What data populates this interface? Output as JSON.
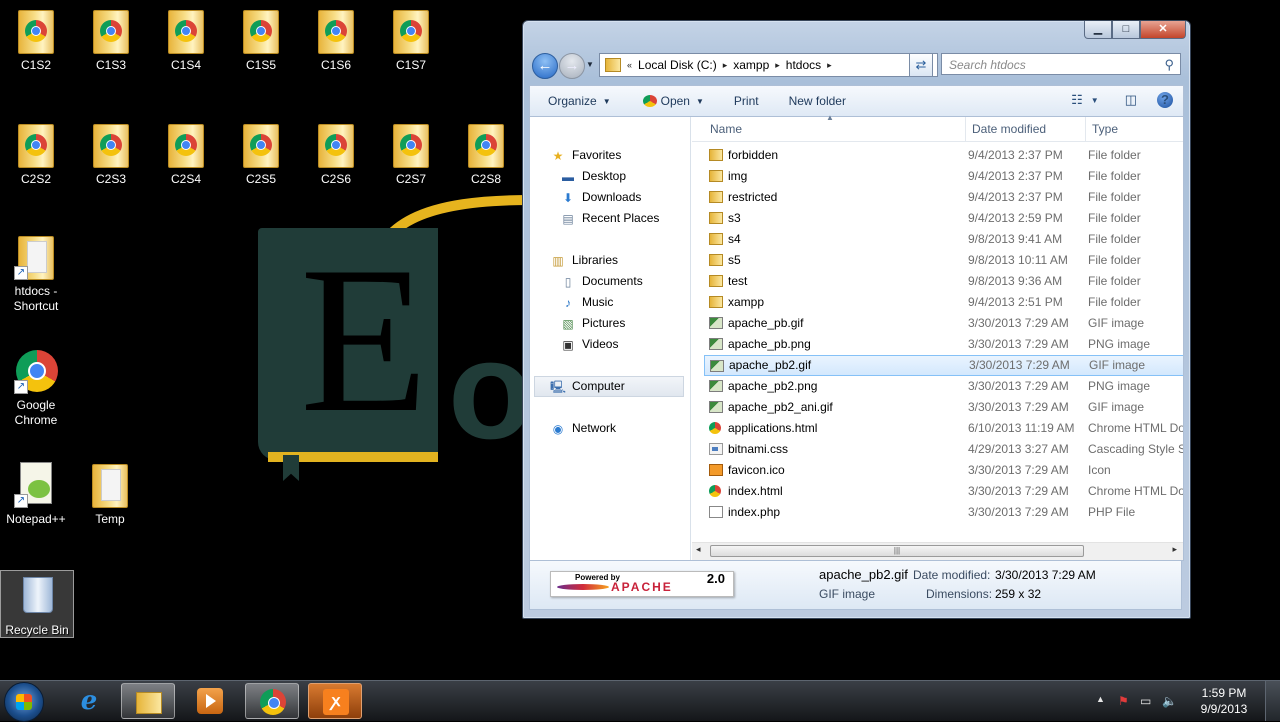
{
  "desktop": {
    "icons_row1": [
      "C1S2",
      "C1S3",
      "C1S4",
      "C1S5",
      "C1S6",
      "C1S7"
    ],
    "icons_row2": [
      "C2S2",
      "C2S3",
      "C2S4",
      "C2S5",
      "C2S6",
      "C2S7",
      "C2S8"
    ],
    "shortcut_htdocs": "htdocs - Shortcut",
    "chrome": "Google Chrome",
    "notepad": "Notepad++",
    "temp": "Temp",
    "recycle": "Recycle Bin"
  },
  "explorer": {
    "address": {
      "segments": [
        "Local Disk (C:)",
        "xampp",
        "htdocs"
      ]
    },
    "search_placeholder": "Search htdocs",
    "toolbar": {
      "organize": "Organize",
      "open": "Open",
      "print": "Print",
      "new_folder": "New folder"
    },
    "nav": {
      "favorites": "Favorites",
      "desktop": "Desktop",
      "downloads": "Downloads",
      "recent": "Recent Places",
      "libraries": "Libraries",
      "documents": "Documents",
      "music": "Music",
      "pictures": "Pictures",
      "videos": "Videos",
      "computer": "Computer",
      "network": "Network"
    },
    "columns": {
      "name": "Name",
      "date": "Date modified",
      "type": "Type"
    },
    "files": [
      {
        "name": "forbidden",
        "date": "9/4/2013 2:37 PM",
        "type": "File folder",
        "icon": "folder"
      },
      {
        "name": "img",
        "date": "9/4/2013 2:37 PM",
        "type": "File folder",
        "icon": "folder"
      },
      {
        "name": "restricted",
        "date": "9/4/2013 2:37 PM",
        "type": "File folder",
        "icon": "folder"
      },
      {
        "name": "s3",
        "date": "9/4/2013 2:59 PM",
        "type": "File folder",
        "icon": "folder"
      },
      {
        "name": "s4",
        "date": "9/8/2013 9:41 AM",
        "type": "File folder",
        "icon": "folder"
      },
      {
        "name": "s5",
        "date": "9/8/2013 10:11 AM",
        "type": "File folder",
        "icon": "folder"
      },
      {
        "name": "test",
        "date": "9/8/2013 9:36 AM",
        "type": "File folder",
        "icon": "folder"
      },
      {
        "name": "xampp",
        "date": "9/4/2013 2:51 PM",
        "type": "File folder",
        "icon": "folder"
      },
      {
        "name": "apache_pb.gif",
        "date": "3/30/2013 7:29 AM",
        "type": "GIF image",
        "icon": "img"
      },
      {
        "name": "apache_pb.png",
        "date": "3/30/2013 7:29 AM",
        "type": "PNG image",
        "icon": "img"
      },
      {
        "name": "apache_pb2.gif",
        "date": "3/30/2013 7:29 AM",
        "type": "GIF image",
        "icon": "img"
      },
      {
        "name": "apache_pb2.png",
        "date": "3/30/2013 7:29 AM",
        "type": "PNG image",
        "icon": "img"
      },
      {
        "name": "apache_pb2_ani.gif",
        "date": "3/30/2013 7:29 AM",
        "type": "GIF image",
        "icon": "img"
      },
      {
        "name": "applications.html",
        "date": "6/10/2013 11:19 AM",
        "type": "Chrome HTML Do",
        "icon": "chrome"
      },
      {
        "name": "bitnami.css",
        "date": "4/29/2013 3:27 AM",
        "type": "Cascading Style S",
        "icon": "css"
      },
      {
        "name": "favicon.ico",
        "date": "3/30/2013 7:29 AM",
        "type": "Icon",
        "icon": "ico"
      },
      {
        "name": "index.html",
        "date": "3/30/2013 7:29 AM",
        "type": "Chrome HTML Do",
        "icon": "chrome"
      },
      {
        "name": "index.php",
        "date": "3/30/2013 7:29 AM",
        "type": "PHP File",
        "icon": "php"
      }
    ],
    "selected_row": 10,
    "details": {
      "filename": "apache_pb2.gif",
      "filetype": "GIF image",
      "date_label": "Date modified:",
      "date_value": "3/30/2013 7:29 AM",
      "dim_label": "Dimensions:",
      "dim_value": "259 x 32",
      "thumb_powered": "Powered by",
      "thumb_apache": "APACHE",
      "thumb_version": "2.0"
    }
  },
  "taskbar": {
    "time": "1:59 PM",
    "date": "9/9/2013"
  }
}
